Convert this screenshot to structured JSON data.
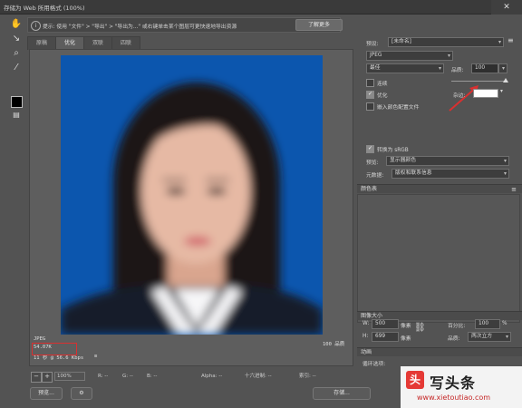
{
  "window": {
    "title": "存储为 Web 所用格式 (100%)",
    "close_label": "✕"
  },
  "infobar": {
    "tip": "提示: 使用 \"文件\" > \"导出\" > \"导出为...\" 或右键单击某个图层可更快速地导出资源",
    "learn_more": "了解更多"
  },
  "tabs": [
    {
      "label": "原稿"
    },
    {
      "label": "优化"
    },
    {
      "label": "双联"
    },
    {
      "label": "四联"
    }
  ],
  "preview": {
    "format": "JPEG",
    "file_size": "54.07K",
    "download_time": "11 秒 @ 56.6 Kbps",
    "menu_icon": "≡",
    "quality_text": "100 品质"
  },
  "status": {
    "zoom": "100%",
    "r": "R: --",
    "g": "G: --",
    "b": "B: --",
    "alpha": "Alpha: --",
    "hex": "十六进制: --",
    "index": "索引: --"
  },
  "bottom_buttons": {
    "preview": "预览...",
    "browser_icon": "⚙",
    "save": "存储..."
  },
  "settings": {
    "preset_label": "预设:",
    "preset_value": "[未命名]",
    "format": "JPEG",
    "quality_level": "最佳",
    "quality_label": "品质:",
    "quality_value": "100",
    "quality_fraction": 1.0,
    "progressive_label": "连续",
    "optimized_label": "优化",
    "optimized_checked": true,
    "blur_label": "杂边:",
    "embed_profile_label": "嵌入颜色配置文件",
    "convert_srgb_label": "转换为 sRGB",
    "convert_srgb_checked": true,
    "preview_label": "预览:",
    "preview_value": "显示器颜色",
    "metadata_label": "元数据:",
    "metadata_value": "版权和联系信息",
    "color_table_label": "颜色表"
  },
  "image_size": {
    "section_label": "图像大小",
    "w_label": "W:",
    "w_value": "500",
    "h_label": "H:",
    "h_value": "699",
    "unit": "像素",
    "percent_label": "百分比:",
    "percent_value": "100",
    "percent_unit": "%",
    "quality_label": "品质:",
    "quality_value": "两次立方"
  },
  "animation": {
    "section_label": "动画",
    "loop_label": "循环选项:"
  },
  "watermark": {
    "logo": "头",
    "text": "写头条",
    "url": "www.xietoutiao.com"
  },
  "colors": {
    "photo_bg": "#0c56ae",
    "annotation": "#d93030"
  }
}
